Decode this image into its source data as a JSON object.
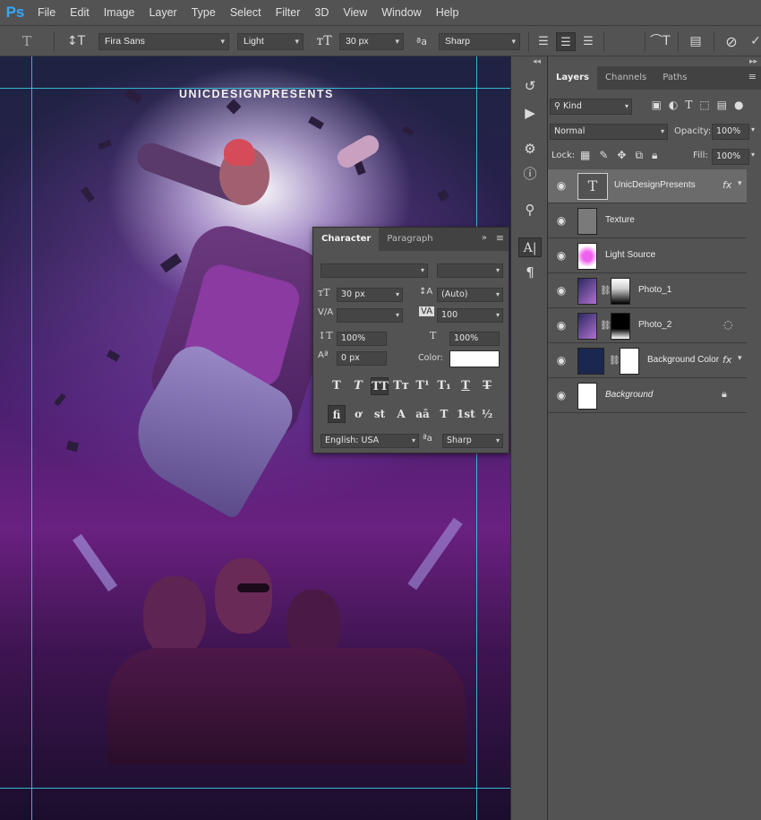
{
  "app": {
    "logo": "Ps"
  },
  "menu": [
    "File",
    "Edit",
    "Image",
    "Layer",
    "Type",
    "Select",
    "Filter",
    "3D",
    "View",
    "Window",
    "Help"
  ],
  "options_bar": {
    "tool_icon": "type-tool-icon",
    "font_family": "Fira Sans",
    "font_style": "Light",
    "font_size": "30 px",
    "antialias_label": "aa",
    "antialias": "Sharp",
    "text_color": "#ffffff"
  },
  "document": {
    "title_text": "UNICDESIGNPRESENTS",
    "guide_color": "#35c8e0"
  },
  "character_panel": {
    "tabs": [
      "Character",
      "Paragraph"
    ],
    "font_family": "",
    "font_style": "",
    "font_size": "30 px",
    "leading": "(Auto)",
    "kerning": "",
    "tracking": "100",
    "vertical_scale": "100%",
    "horizontal_scale": "100%",
    "baseline_shift": "0 px",
    "color_label": "Color:",
    "color": "#ffffff",
    "type_buttons": [
      "T",
      "T",
      "TT",
      "Tт",
      "T¹",
      "T₁",
      "T",
      "T"
    ],
    "opentype_buttons": [
      "fi",
      "ơ",
      "st",
      "A",
      "aā",
      "T",
      "1st",
      "½"
    ],
    "language": "English: USA",
    "antialias": "Sharp"
  },
  "layers_panel": {
    "tabs": [
      "Layers",
      "Channels",
      "Paths"
    ],
    "filter_kind": "Kind",
    "blend_mode": "Normal",
    "opacity_label": "Opacity:",
    "opacity": "100%",
    "lock_label": "Lock:",
    "fill_label": "Fill:",
    "fill": "100%",
    "layers": [
      {
        "name": "UnicDesignPresents",
        "type": "text",
        "fx": "fx",
        "selected": true
      },
      {
        "name": "Texture",
        "type": "smart"
      },
      {
        "name": "Light Source",
        "type": "pixel"
      },
      {
        "name": "Photo_1",
        "type": "photo-mask"
      },
      {
        "name": "Photo_2",
        "type": "photo-mask"
      },
      {
        "name": "Background Color",
        "type": "fill",
        "fx": "fx"
      },
      {
        "name": "Background",
        "type": "background",
        "locked": true
      }
    ]
  }
}
